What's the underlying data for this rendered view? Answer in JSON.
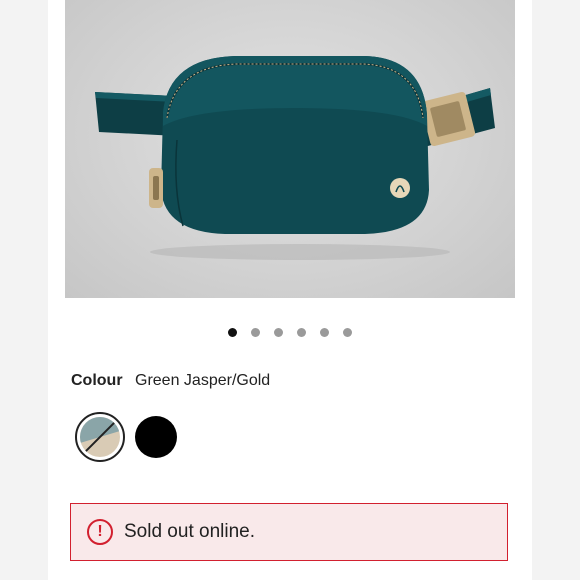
{
  "carousel": {
    "total": 6,
    "active_index": 0
  },
  "colour": {
    "label": "Colour",
    "value": "Green Jasper/Gold"
  },
  "swatches": [
    {
      "name": "Green Jasper/Gold",
      "selected": true,
      "unavailable": true
    },
    {
      "name": "Black",
      "selected": false,
      "unavailable": false
    }
  ],
  "alert": {
    "icon": "exclamation-circle-icon",
    "text": "Sold out online.",
    "color": "#d2202f"
  },
  "colors": {
    "bag": "#0f4a52",
    "hardware": "#cdb58a",
    "accent_alert": "#d2202f"
  }
}
